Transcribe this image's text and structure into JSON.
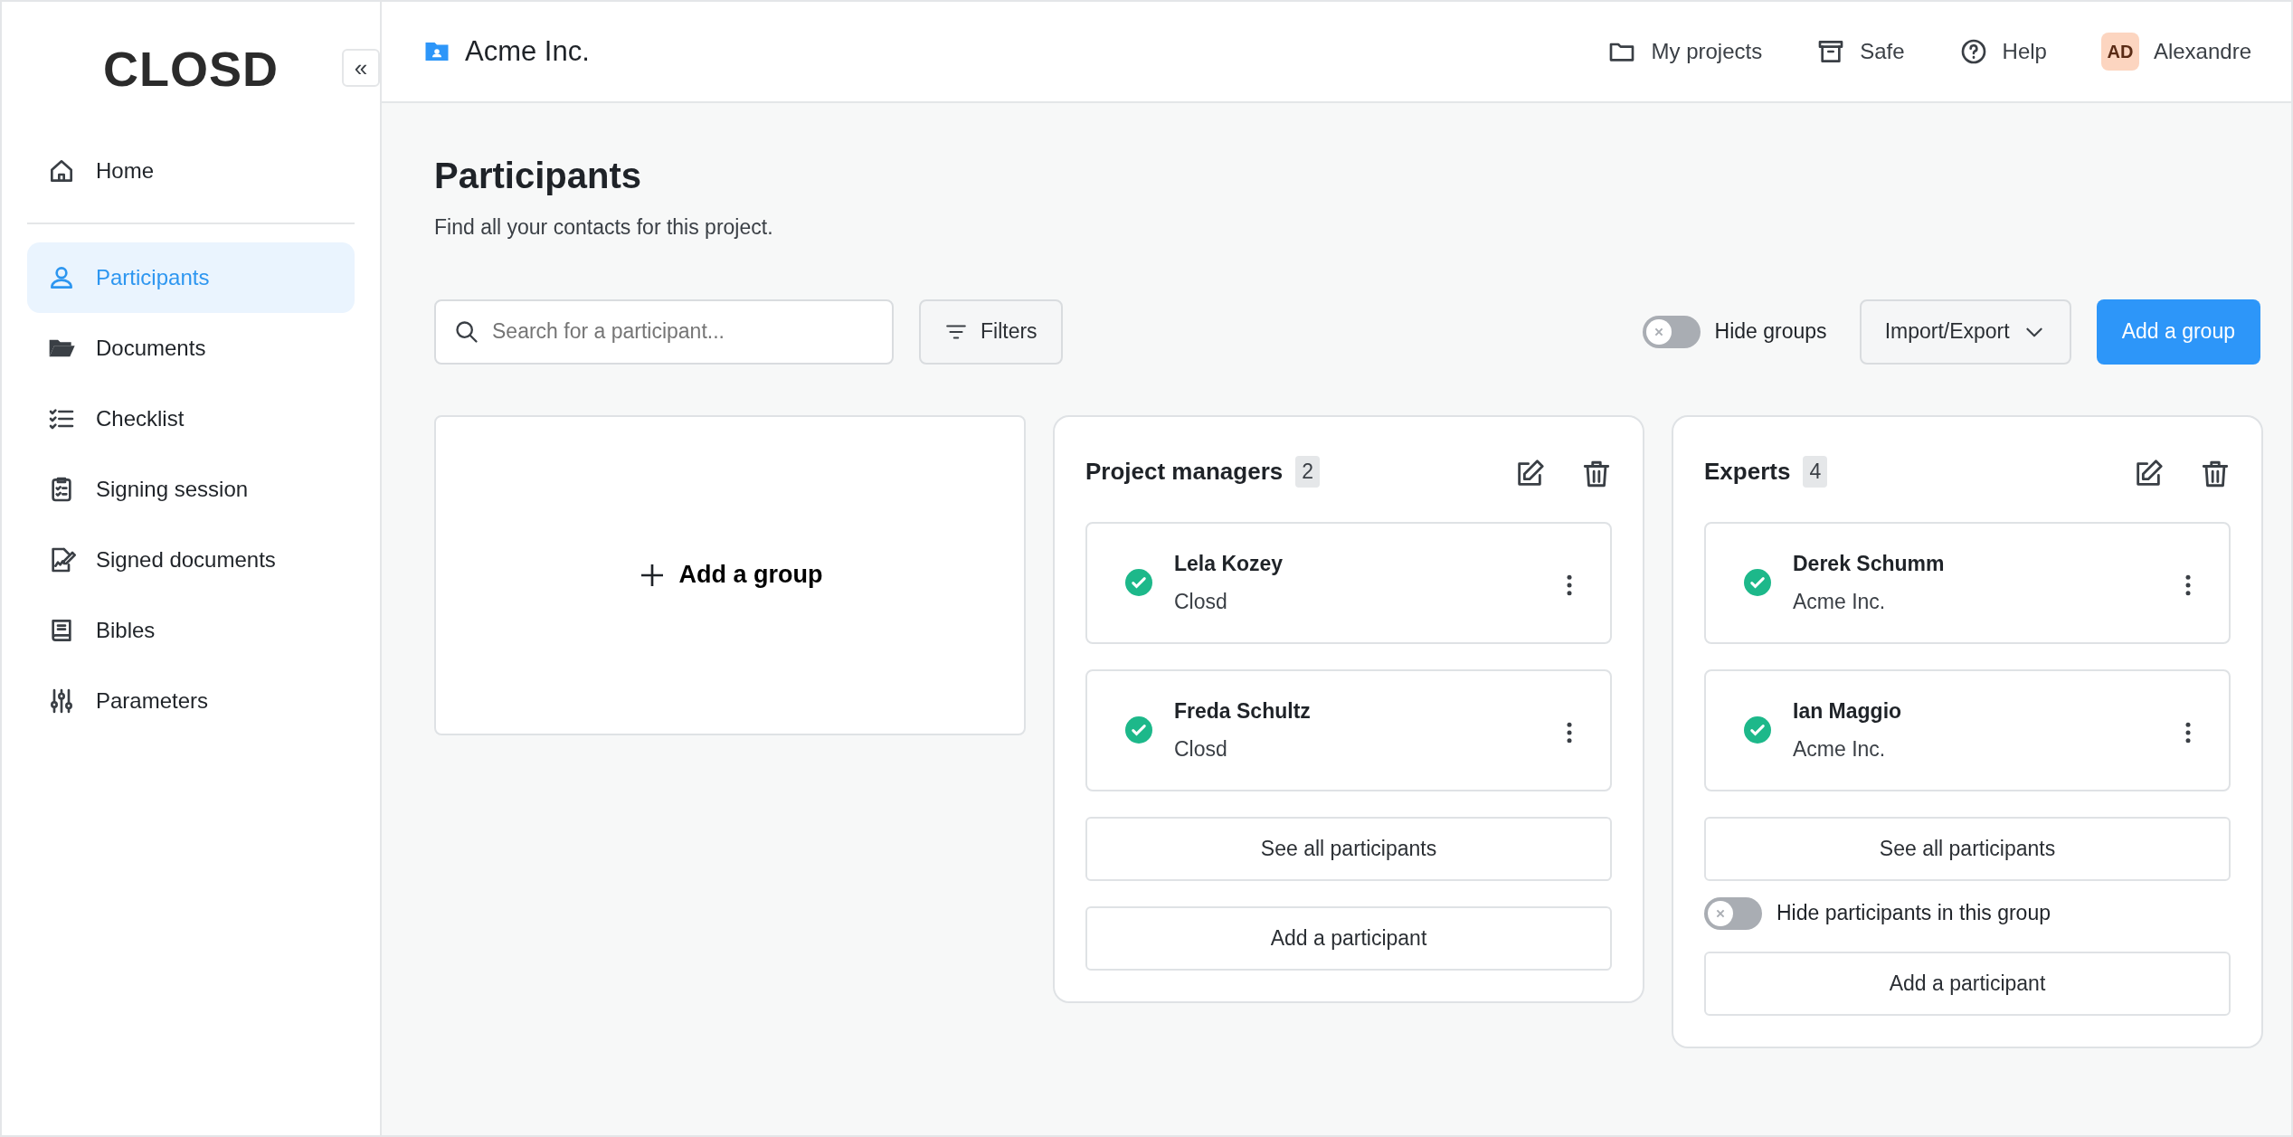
{
  "sidebar": {
    "logo": "CLOSD",
    "collapse_label": "«",
    "items": [
      {
        "label": "Home",
        "selected": false
      },
      {
        "label": "Participants",
        "selected": true
      },
      {
        "label": "Documents",
        "selected": false
      },
      {
        "label": "Checklist",
        "selected": false
      },
      {
        "label": "Signing session",
        "selected": false
      },
      {
        "label": "Signed documents",
        "selected": false
      },
      {
        "label": "Bibles",
        "selected": false
      },
      {
        "label": "Parameters",
        "selected": false
      }
    ]
  },
  "header": {
    "project": "Acme Inc.",
    "links": [
      {
        "label": "My projects"
      },
      {
        "label": "Safe"
      },
      {
        "label": "Help"
      }
    ],
    "user": {
      "initials": "AD",
      "name": "Alexandre"
    }
  },
  "page": {
    "title": "Participants",
    "subtitle": "Find all your contacts for this project."
  },
  "toolbar": {
    "search": {
      "placeholder": "Search for a participant..."
    },
    "filters": "Filters",
    "hide_groups": {
      "label": "Hide groups",
      "on": false
    },
    "import_export": "Import/Export",
    "add_group": "Add a group"
  },
  "groups": [
    {
      "kind": "add",
      "label": "Add a group"
    },
    {
      "kind": "group",
      "name": "Project managers",
      "count": "2",
      "participants": [
        {
          "name": "Lela Kozey",
          "company": "Closd",
          "verified": true
        },
        {
          "name": "Freda Schultz",
          "company": "Closd",
          "verified": true
        }
      ],
      "see_all": "See all participants",
      "add_participant": "Add a participant"
    },
    {
      "kind": "group",
      "name": "Experts",
      "count": "4",
      "participants": [
        {
          "name": "Derek Schumm",
          "company": "Acme Inc.",
          "verified": true
        },
        {
          "name": "Ian Maggio",
          "company": "Acme Inc.",
          "verified": true
        }
      ],
      "see_all": "See all participants",
      "hide_toggle": {
        "label": "Hide participants in this group",
        "on": false
      },
      "add_participant": "Add a participant"
    }
  ]
}
